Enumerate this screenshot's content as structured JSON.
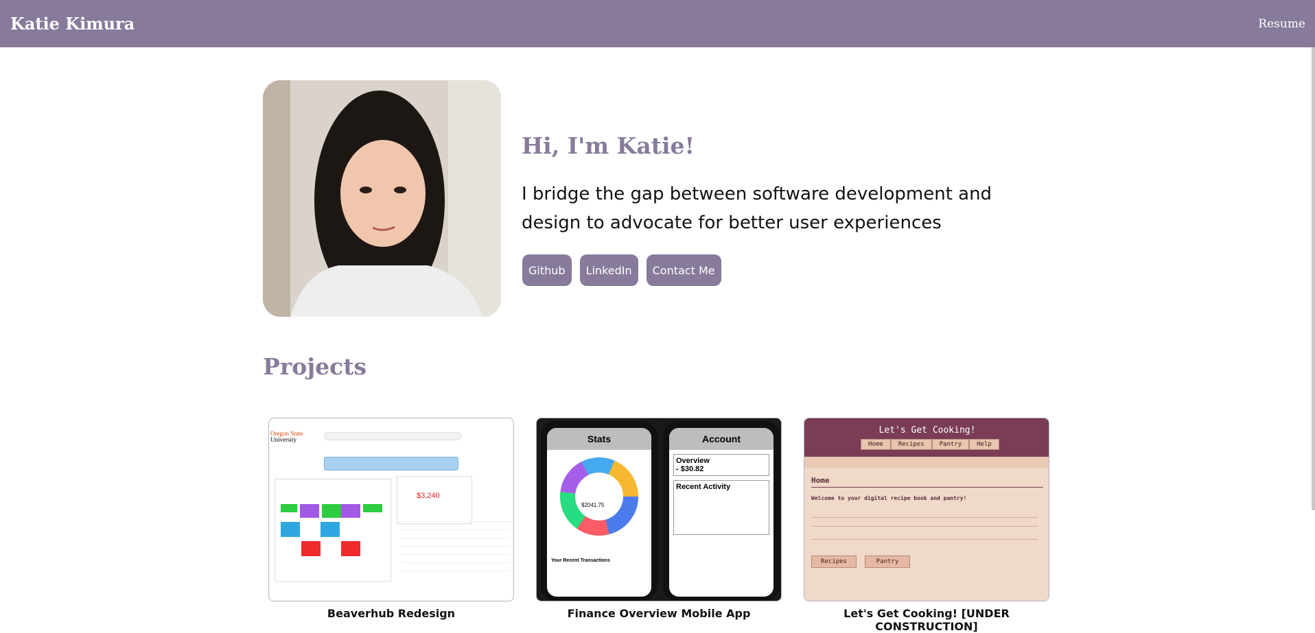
{
  "nav": {
    "brand": "Katie Kimura",
    "resume_label": "Resume"
  },
  "hero": {
    "greeting": "Hi, I'm Katie!",
    "tagline": "I bridge the gap between software development and design to advocate for better user experiences",
    "buttons": [
      "Github",
      "LinkedIn",
      "Contact Me"
    ]
  },
  "projects": {
    "title": "Projects",
    "items": [
      {
        "caption": "Beaverhub Redesign"
      },
      {
        "caption": "Finance Overview Mobile App"
      },
      {
        "caption": "Let's Get Cooking! [UNDER CONSTRUCTION]"
      }
    ]
  },
  "thumb_beaverhub": {
    "logo_line1": "Oregon State",
    "logo_line2": "University",
    "finance_value": "$3,240"
  },
  "thumb_finance": {
    "left_title": "Stats",
    "right_title": "Account",
    "donut_total": "$2041.75",
    "overview_label": "Overview",
    "overview_value": "- $30.82",
    "recent_label": "Recent Activity",
    "transactions_label": "Your Recent Transactions"
  },
  "thumb_cooking": {
    "title": "Let's Get Cooking!",
    "nav": [
      "Home",
      "Recipes",
      "Pantry",
      "Help"
    ],
    "heading": "Home",
    "welcome": "Welcome to your digital recipe book and pantry!",
    "buttons": [
      "Recipes",
      "Pantry"
    ]
  },
  "colors": {
    "accent": "#877a9b",
    "nav_text": "#ffffff"
  }
}
